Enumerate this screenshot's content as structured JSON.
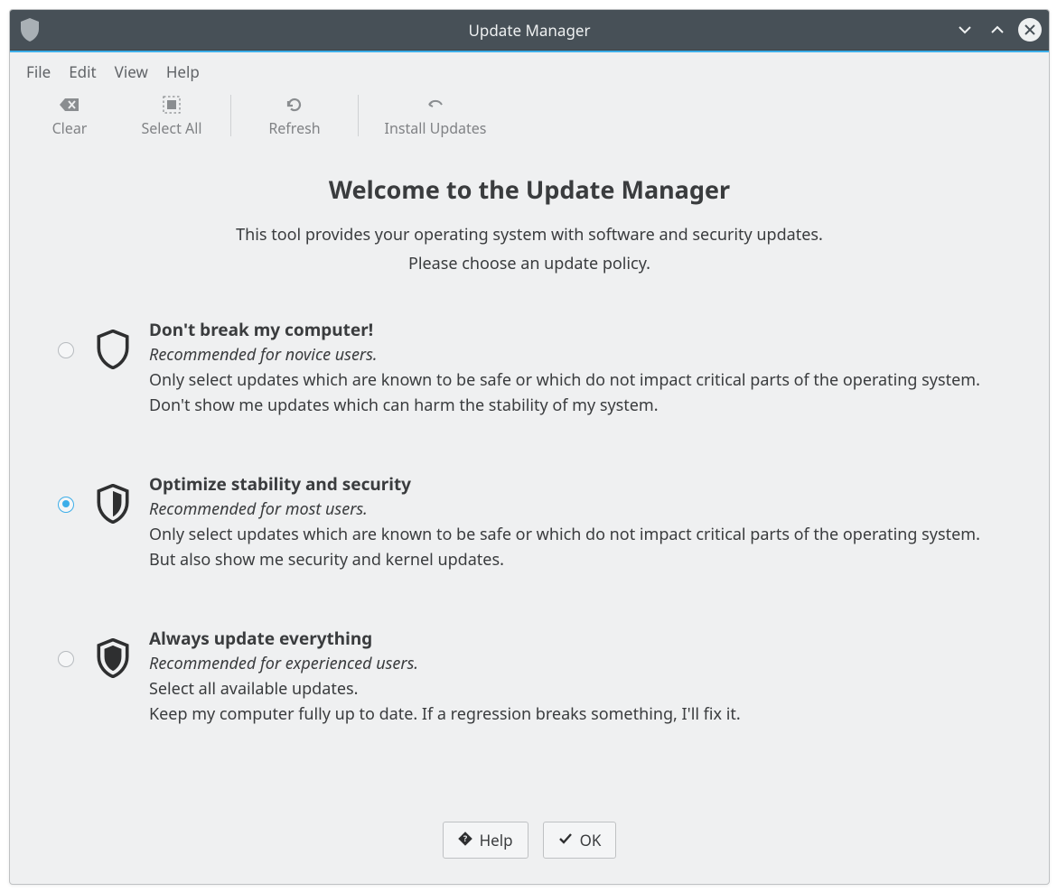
{
  "window": {
    "title": "Update Manager"
  },
  "menubar": {
    "file": "File",
    "edit": "Edit",
    "view": "View",
    "help": "Help"
  },
  "toolbar": {
    "clear": "Clear",
    "select_all": "Select All",
    "refresh": "Refresh",
    "install": "Install Updates"
  },
  "headline": "Welcome to the Update Manager",
  "intro": {
    "line1": "This tool provides your operating system with software and security updates.",
    "line2": "Please choose an update policy."
  },
  "policies": {
    "safe": {
      "title": "Don't break my computer!",
      "rec": "Recommended for novice users.",
      "desc1": "Only select updates which are known to be safe or which do not impact critical parts of the operating system.",
      "desc2": "Don't show me updates which can harm the stability of my system."
    },
    "balanced": {
      "title": "Optimize stability and security",
      "rec": "Recommended for most users.",
      "desc1": "Only select updates which are known to be safe or which do not impact critical parts of the operating system.",
      "desc2": "But also show me security and kernel updates."
    },
    "all": {
      "title": "Always update everything",
      "rec": "Recommended for experienced users.",
      "desc1": "Select all available updates.",
      "desc2": "Keep my computer fully up to date. If a regression breaks something, I'll fix it."
    }
  },
  "footer": {
    "help": "Help",
    "ok": "OK"
  }
}
